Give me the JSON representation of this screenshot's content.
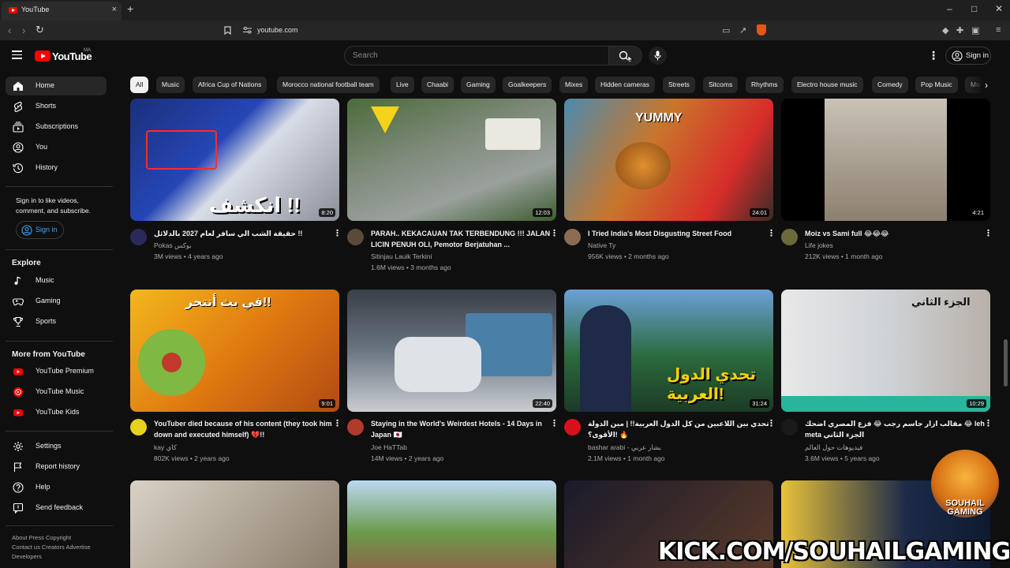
{
  "browser": {
    "tab_title": "YouTube",
    "tab_close": "×",
    "new_tab": "+",
    "url": "youtube.com",
    "win_min": "–",
    "win_max": "□",
    "win_close": "✕"
  },
  "header": {
    "logo_text": "YouTube",
    "country_code": "MA",
    "search_placeholder": "Search",
    "more": "⋮",
    "signin": "Sign in"
  },
  "sidebar": {
    "main": [
      {
        "label": "Home",
        "icon": "home-icon"
      },
      {
        "label": "Shorts",
        "icon": "shorts-icon"
      },
      {
        "label": "Subscriptions",
        "icon": "subscriptions-icon"
      },
      {
        "label": "You",
        "icon": "you-icon"
      },
      {
        "label": "History",
        "icon": "history-icon"
      }
    ],
    "signin_note": "Sign in to like videos, comment, and subscribe.",
    "signin_button": "Sign in",
    "explore_heading": "Explore",
    "explore": [
      {
        "label": "Music"
      },
      {
        "label": "Gaming"
      },
      {
        "label": "Sports"
      }
    ],
    "more_heading": "More from YouTube",
    "more": [
      {
        "label": "YouTube Premium"
      },
      {
        "label": "YouTube Music"
      },
      {
        "label": "YouTube Kids"
      }
    ],
    "settings": [
      {
        "label": "Settings"
      },
      {
        "label": "Report history"
      },
      {
        "label": "Help"
      },
      {
        "label": "Send feedback"
      }
    ],
    "footer": {
      "line1": "About  Press  Copyright",
      "line2": "Contact us  Creators  Advertise",
      "line3": "Developers"
    }
  },
  "chips": [
    "All",
    "Music",
    "Africa Cup of Nations",
    "Morocco national football team",
    "Live",
    "Chaabi",
    "Gaming",
    "Goalkeepers",
    "Mixes",
    "Hidden cameras",
    "Streets",
    "Sitcoms",
    "Rhythms",
    "Electro house music",
    "Comedy",
    "Pop Music",
    "Mo"
  ],
  "videos": [
    {
      "title": "حقيقة الشب الي سافر لعام 2027 بالدلائل !!",
      "channel": "Pokas بوكس",
      "meta": "3M views • 4 years ago",
      "duration": "8:20",
      "thumb_text": "انكشف !!"
    },
    {
      "title": "PARAH.. KEKACAUAN TAK TERBENDUNG !!! JALAN LICIN PENUH OLI, Pemotor Berjatuhan ...",
      "channel": "Sitinjau Lauik Terkini",
      "meta": "1.6M views • 3 months ago",
      "duration": "12:03",
      "thumb_text": ""
    },
    {
      "title": "I Tried India's Most Disgusting Street Food",
      "channel": "Native Ty",
      "meta": "956K views • 2 months ago",
      "duration": "24:01",
      "thumb_text": "YUMMY"
    },
    {
      "title": "Moiz vs Sami full 😂😂😂",
      "channel": "Life jokes",
      "meta": "212K views • 1 month ago",
      "duration": "4:21",
      "thumb_text": ""
    },
    {
      "title": "YouTuber died because of his content (they took him down and executed himself) 💔!!",
      "channel": "kay كاي",
      "meta": "802K views • 2 years ago",
      "duration": "9:01",
      "thumb_text": "في بث أنتحر!!"
    },
    {
      "title": "Staying in the World's Weirdest Hotels - 14 Days in Japan 🇯🇵",
      "channel": "Joe HaTTab",
      "meta": "14M views • 2 years ago",
      "duration": "22:40",
      "thumb_text": ""
    },
    {
      "title": "تحدي بين اللاعبين من كل الدول العربية!! | مين الدولة الأقوى؟! 🔥",
      "channel": "bashar arabi - بشار عربي",
      "meta": "2.1M views • 1 month ago",
      "duration": "31:24",
      "thumb_text": "تحدي الدول العربية!"
    },
    {
      "title": "مقالب ازار جاسم رجب 😂 فزع المصري اضحك 😂 leh meta الجزء الثاني",
      "channel": "فيديوهات حول العالم",
      "meta": "3.6M views • 5 years ago",
      "duration": "10:29",
      "thumb_text": "الجزء الثاني"
    }
  ],
  "overlay": {
    "stream_text": "KICK.COM/SOUHAILGAMING",
    "logo_text": "SOUHAIL GAMING"
  },
  "colors": {
    "background": "#0f0f0f",
    "chip": "#272727",
    "accent_red": "#ff0000",
    "link_blue": "#3ea6ff"
  }
}
